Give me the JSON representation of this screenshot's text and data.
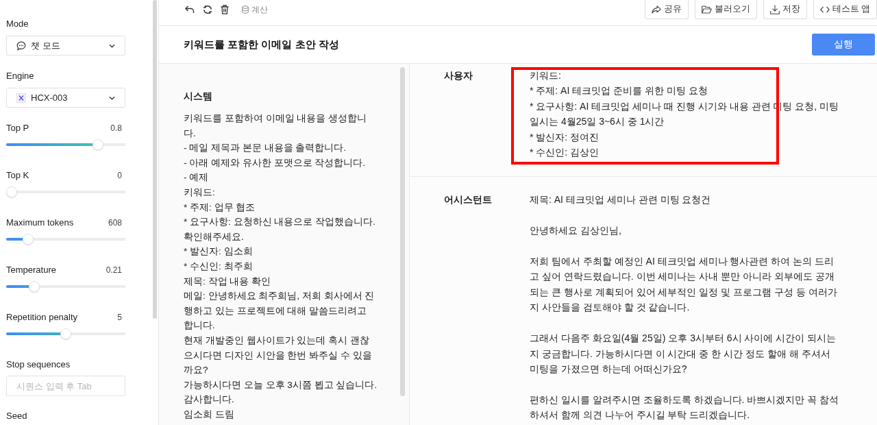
{
  "sidebar": {
    "controls": [
      {
        "kind": "mode",
        "label": "Mode",
        "value": "챗 모드"
      },
      {
        "kind": "engine",
        "label": "Engine",
        "value": "HCX-003"
      },
      {
        "kind": "slider",
        "label": "Top P",
        "reading": "0.8",
        "level": 0.8
      },
      {
        "kind": "slider",
        "label": "Top K",
        "reading": "0",
        "level": 0
      },
      {
        "kind": "slider",
        "label": "Maximum tokens",
        "reading": "608",
        "level": 0.15
      },
      {
        "kind": "slider",
        "label": "Temperature",
        "reading": "0.21",
        "level": 0.21
      },
      {
        "kind": "slider",
        "label": "Repetition penalty",
        "reading": "5",
        "level": 0.5
      },
      {
        "kind": "input",
        "label": "Stop sequences",
        "placeholder": "시퀀스 입력 후 Tab"
      },
      {
        "kind": "label",
        "label": "Seed"
      }
    ]
  },
  "toolbar": {
    "calc_label": "계산",
    "actions": [
      {
        "kind": "share",
        "label": "공유"
      },
      {
        "kind": "load",
        "label": "불러오기"
      },
      {
        "kind": "save",
        "label": "저장"
      },
      {
        "kind": "test-app",
        "label": "테스트 앱"
      }
    ]
  },
  "prompt": {
    "title": "키워드를 포함한 이메일 초안 작성",
    "run_label": "실행"
  },
  "system": {
    "heading": "시스템",
    "text": "키워드를 포함하여 이메일 내용을 생성합니다.\n- 메일 제목과 본문 내용을 출력합니다.\n- 아래 예제와 유사한 포맷으로 작성합니다.\n- 예제\n키워드:\n* 주제: 업무 협조\n* 요구사항: 요청하신 내용으로 작업했습니다. 확인해주세요.\n* 발신자: 임소희\n* 수신인: 최주희\n제목: 작업 내용 확인\n메일: 안녕하세요 최주희님, 저희 회사에서 진행하고 있는 프로젝트에 대해 말씀드리려고 합니다.\n현재 개발중인 웹사이트가 있는데 혹시 괜찮으시다면 디자인 시안을 한번 봐주실 수 있을까요?\n가능하시다면 오늘 오후 3시쯤 뵙고 싶습니다.\n감사합니다.\n임소희 드림"
  },
  "messages": [
    {
      "role": "사용자",
      "highlighted": true,
      "text": "키워드:\n* 주제: AI 테크밋업 준비를 위한 미팅 요청\n* 요구사항: AI 테크밋업 세미나 때 진행 시기와 내용 관련 미팅 요청, 미팅 일시는 4월25일 3~6시 중 1시간\n* 발신자: 정여진\n* 수신인: 김상인"
    },
    {
      "role": "어시스턴트",
      "highlighted": false,
      "text": "제목: AI 테크밋업 세미나 관련 미팅 요청건\n\n안녕하세요 김상인님,\n\n저희 팀에서 주최할 예정인 AI 테크밋업 세미나 행사관련 하여 논의 드리고 싶어 연락드렸습니다. 이번 세미나는 사내 뿐만 아니라 외부에도 공개되는 큰 행사로 계획되어 있어 세부적인 일정 및 프로그램 구성 등 여러가지 사안들을 검토해야 할 것 같습니다.\n\n그래서 다음주 화요일(4월 25일) 오후 3시부터 6시 사이에 시간이 되시는지 궁금합니다. 가능하시다면 이 시간대 중 한 시간 정도 할애 해 주셔서 미팅을 가졌으면 하는데 어떠신가요?\n\n편하신 일시를 알려주시면 조율하도록 하겠습니다. 바쁘시겠지만 꼭 참석하셔서 함께 의견 나누어 주시길 부탁 드리겠습니다."
    }
  ]
}
